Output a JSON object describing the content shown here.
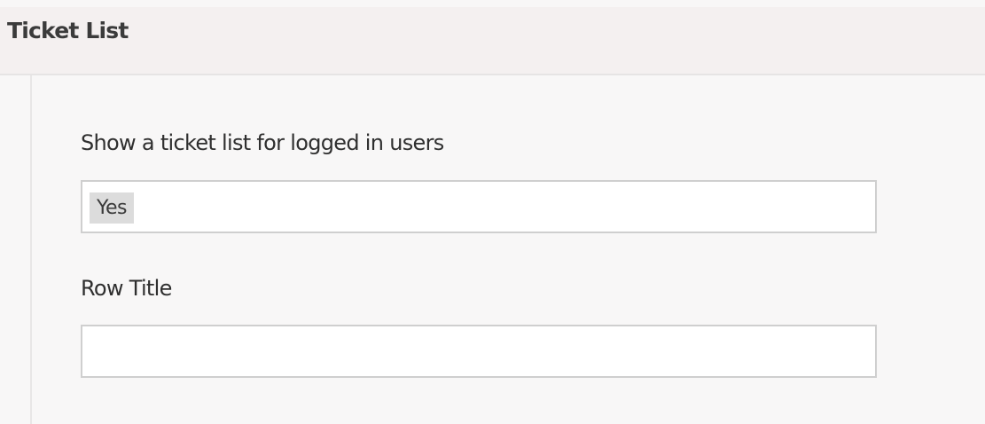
{
  "panel": {
    "title": "Ticket List"
  },
  "fields": [
    {
      "label": "Show a ticket list for logged in users",
      "selected": "Yes"
    },
    {
      "label": "Row Title",
      "value": ""
    }
  ],
  "colors": {
    "header_background": "#f4f0f0",
    "panel_background": "#f8f7f7",
    "field_border": "#cfcfcf",
    "chip_background": "#dcdcdc"
  }
}
